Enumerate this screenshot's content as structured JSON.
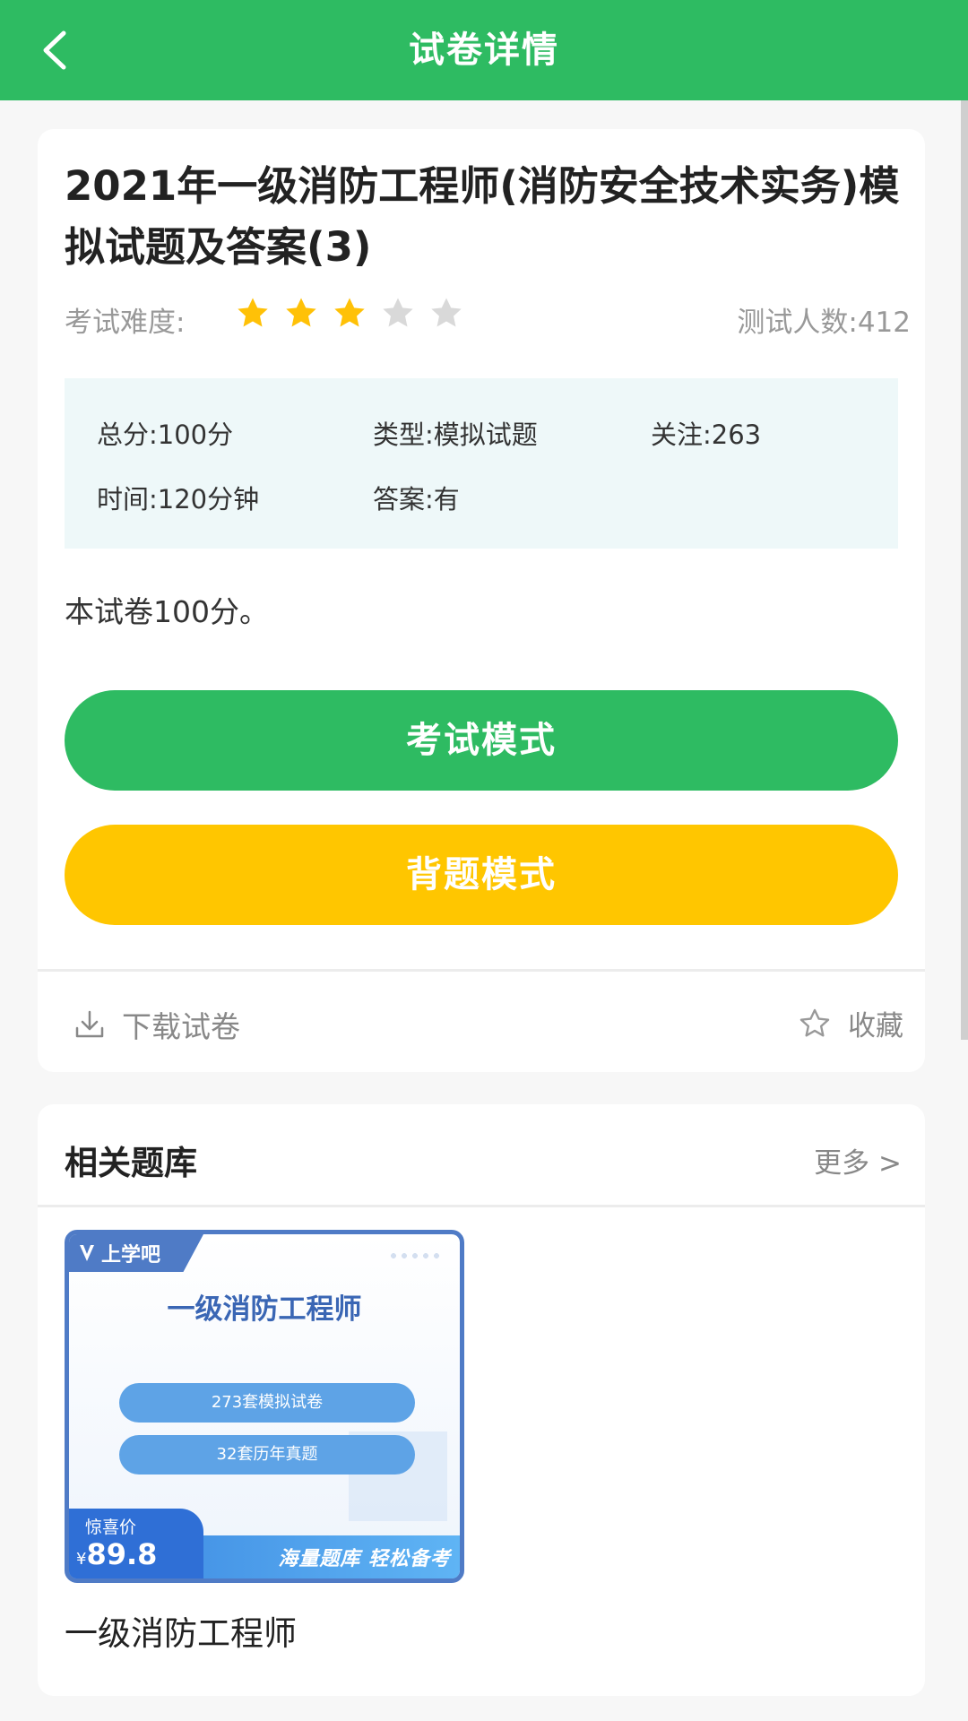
{
  "header": {
    "title": "试卷详情"
  },
  "paper": {
    "title": "2021年一级消防工程师(消防安全技术实务)模拟试题及答案(3)",
    "difficulty_label": "考试难度:",
    "difficulty_rating": 3,
    "difficulty_max": 5,
    "testers": "测试人数:412",
    "info": {
      "total": "总分:100分",
      "type": "类型:模拟试题",
      "follow": "关注:263",
      "time": "时间:120分钟",
      "answer": "答案:有"
    },
    "description": "本试卷100分。",
    "exam_mode_label": "考试模式",
    "memo_mode_label": "背题模式",
    "download_label": "下载试卷",
    "favorite_label": "收藏"
  },
  "colors": {
    "primary": "#2ebb62",
    "accent": "#ffc600",
    "star_on": "#ffc107",
    "star_off": "#d9d9d9"
  },
  "related": {
    "title": "相关题库",
    "more_label": "更多 >",
    "items": [
      {
        "brand": "上学吧",
        "cover_title": "一级消防工程师",
        "mock_count": "273套模拟试卷",
        "real_count": "32套历年真题",
        "price_label": "惊喜价",
        "price_symbol": "¥",
        "price": "89.8",
        "slogan": "海量题库 轻松备考",
        "caption": "一级消防工程师"
      }
    ]
  }
}
